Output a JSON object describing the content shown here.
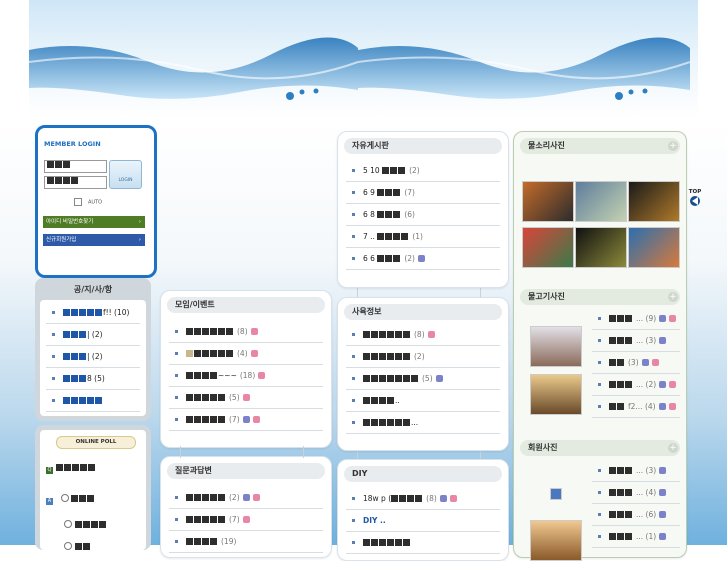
{
  "login": {
    "title": "MEMBER LOGIN",
    "button_label": "LOGIN",
    "auto_label": "AUTO",
    "find_label": "아이디 비밀번호찾기",
    "join_label": "신규회원가입"
  },
  "notice": {
    "title": "공/지/사/항",
    "items": [
      "f!! (10)",
      "| (2)",
      "| (2)",
      "8 (5)",
      ""
    ]
  },
  "poll": {
    "title": "ONLINE POLL"
  },
  "free_board": {
    "title": "자유게시판",
    "items": [
      {
        "text": "5 10",
        "count": "(2)"
      },
      {
        "text": "6 9",
        "count": "(7)"
      },
      {
        "text": "6 8",
        "count": "(6)"
      },
      {
        "text": "7 ..",
        "count": "(1)"
      },
      {
        "text": "6 6",
        "count": "(2)"
      }
    ]
  },
  "events": {
    "title": "모임/이벤트",
    "items": [
      {
        "text": "...",
        "count": "(8)"
      },
      {
        "text": "...",
        "count": "(4)"
      },
      {
        "text": "~~~",
        "count": "(18)"
      },
      {
        "text": "...",
        "count": "(5)"
      },
      {
        "text": "...",
        "count": "(7)"
      }
    ]
  },
  "breeding": {
    "title": "사육정보",
    "items": [
      {
        "text": "",
        "count": "(8)"
      },
      {
        "text": "",
        "count": "(2)"
      },
      {
        "text": "",
        "count": "(5)"
      },
      {
        "text": "..",
        "count": ""
      },
      {
        "text": "...",
        "count": ""
      }
    ]
  },
  "qa": {
    "title": "질문과답변",
    "items": [
      {
        "text": "...",
        "count": "(2)"
      },
      {
        "text": "...",
        "count": "(7)"
      },
      {
        "text": "...",
        "count": "(19)"
      }
    ]
  },
  "diy": {
    "title": "DIY",
    "items": [
      {
        "text": "18w p (",
        "count": "(8)"
      },
      {
        "text": "DIY ..",
        "count": ""
      },
      {
        "text": "",
        "count": ""
      }
    ]
  },
  "photo1": {
    "title": "물소리사진"
  },
  "photo2": {
    "title": "물고기사진",
    "items": [
      "... (9)",
      "... (3)",
      "(3)",
      "... (2)",
      "f2... (4)"
    ]
  },
  "photo3": {
    "title": "회원사진",
    "items": [
      "... (3)",
      "... (4)",
      "... (6)",
      "... (1)"
    ]
  },
  "top_button": "TOP",
  "colors": {
    "login_border": "#1e72c4",
    "green_button": "#4f7d26",
    "blue_button": "#2f5aa8",
    "accent_pink": "#e986a6"
  }
}
